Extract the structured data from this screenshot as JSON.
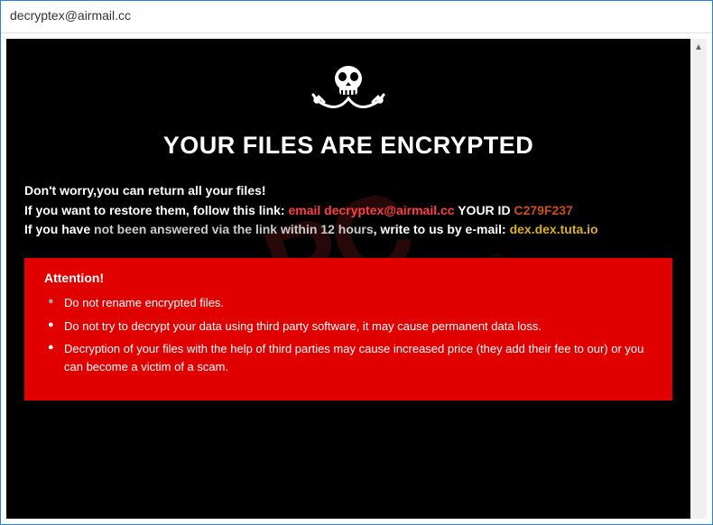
{
  "window": {
    "title": "decryptex@airmail.cc"
  },
  "heading": "YOUR FILES ARE ENCRYPTED",
  "lines": {
    "l1": "Don't worry,you can return all your files!",
    "l2a": "If you want to restore them, follow this link: ",
    "l2_email_prefix": "email ",
    "l2_email": "decryptex@airmail.cc",
    "l2_id_label": "  YOUR ID ",
    "l2_id_value": "C279F237",
    "l3a": "If you have ",
    "l3b": "not been answered via the link within 12 hours",
    "l3c": ", write to us by e-mail: ",
    "l3_email2": "dex.dex.tuta.io"
  },
  "attention": {
    "title": "Attention!",
    "items": [
      "Do not rename encrypted files.",
      "Do not try to decrypt your data using third party software, it may cause permanent data loss.",
      "Decryption of your files with the help of third parties may cause increased price (they add their fee to our) or you can become a victim of a scam."
    ]
  },
  "icons": {
    "skull": "skull-crossbones-icon",
    "scroll_up": "▲"
  },
  "watermark": {
    "line1": "PC",
    "line2": "risk.com"
  }
}
